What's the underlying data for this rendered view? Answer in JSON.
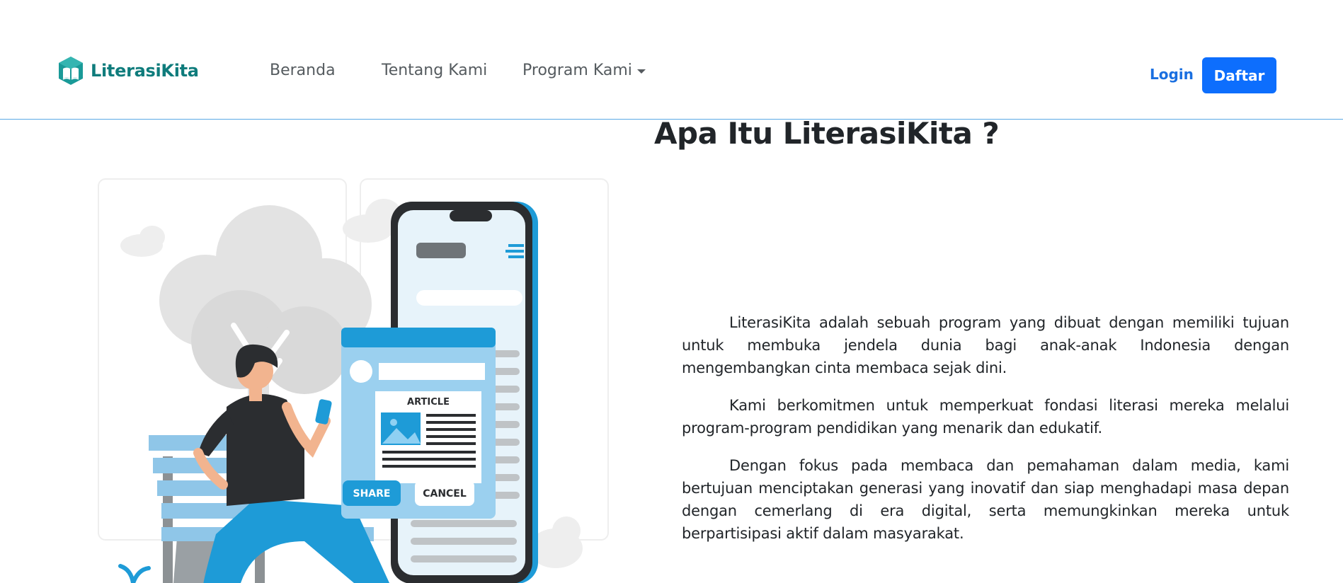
{
  "brand": {
    "name": "LiterasiKita",
    "logo_icon": "open-book-hexagon-icon",
    "color": "#0f7c7c"
  },
  "nav": {
    "beranda": "Beranda",
    "tentang": "Tentang Kami",
    "program": "Program Kami",
    "program_icon": "caret-down-icon"
  },
  "auth": {
    "login": "Login",
    "daftar": "Daftar"
  },
  "colors": {
    "primary": "#0d6efd",
    "accent_blue": "#1e9bd7",
    "navbar_border": "#5aa9e6",
    "text": "#212529"
  },
  "main": {
    "title": "Apa Itu LiterasiKita ?",
    "paragraphs": [
      "LiterasiKita adalah sebuah program yang dibuat dengan memiliki tujuan untuk membuka jendela dunia bagi anak-anak Indonesia dengan mengembangkan cinta membaca sejak dini.",
      "Kami berkomitmen untuk memperkuat fondasi literasi mereka melalui program-program pendidikan yang menarik dan edukatif.",
      "Dengan fokus pada membaca dan pemahaman dalam media, kami bertujuan menciptakan generasi yang inovatif dan siap menghadapi masa depan dengan cemerlang di era digital, serta memungkinkan mereka untuk berpartisipasi aktif dalam masyarakat."
    ]
  },
  "illustration": {
    "card_heading": "ARTICLE",
    "share_button": "SHARE",
    "cancel_button": "CANCEL"
  }
}
